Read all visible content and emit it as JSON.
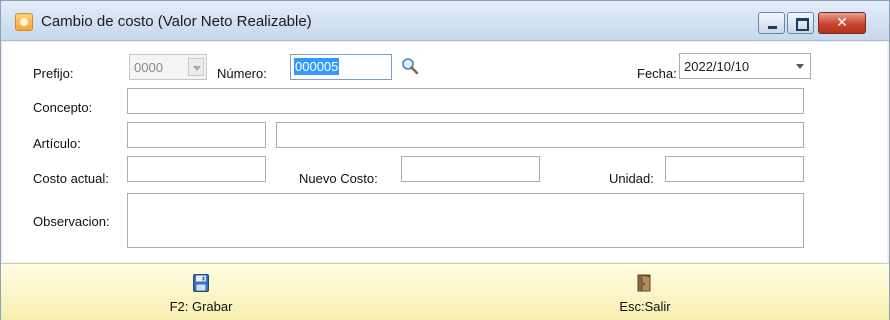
{
  "window": {
    "title": "Cambio de costo (Valor Neto Realizable)",
    "icon": "app-icon",
    "controls": [
      "minimize-icon",
      "maximize-icon",
      "close-icon"
    ]
  },
  "form": {
    "prefijo": {
      "label": "Prefijo:",
      "value": "0000",
      "enabled": false
    },
    "numero": {
      "label": "Número:",
      "value": "000005",
      "selected": true
    },
    "fecha": {
      "label": "Fecha:",
      "value": "2022/10/10"
    },
    "concepto": {
      "label": "Concepto:",
      "value": ""
    },
    "articulo": {
      "label": "Artículo:",
      "code": "",
      "description": ""
    },
    "costo_actual": {
      "label": "Costo actual:",
      "value": ""
    },
    "nuevo_costo": {
      "label": "Nuevo Costo:",
      "value": ""
    },
    "unidad": {
      "label": "Unidad:",
      "value": ""
    },
    "observacion": {
      "label": "Observacion:",
      "value": ""
    }
  },
  "toolbar": {
    "save": {
      "label": "F2: Grabar",
      "icon": "floppy-disk-icon"
    },
    "exit": {
      "label": "Esc:Salir",
      "icon": "door-exit-icon"
    }
  },
  "colors": {
    "selection": "#3399ff",
    "toolbar_bg": "#fbf5c8",
    "close_button": "#c9452f"
  }
}
